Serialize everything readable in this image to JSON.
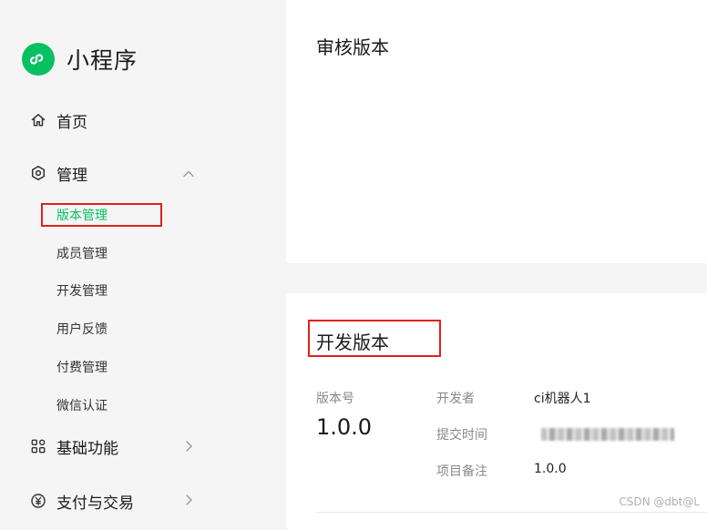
{
  "brand": {
    "title": "小程序",
    "color": "#07c160"
  },
  "nav": {
    "home": {
      "label": "首页",
      "icon": "home-icon"
    },
    "manage": {
      "label": "管理",
      "icon": "hexagon-settings-icon",
      "expanded": true
    },
    "sub_items": [
      {
        "label": "版本管理",
        "active": true
      },
      {
        "label": "成员管理",
        "active": false
      },
      {
        "label": "开发管理",
        "active": false
      },
      {
        "label": "用户反馈",
        "active": false
      },
      {
        "label": "付费管理",
        "active": false
      },
      {
        "label": "微信认证",
        "active": false
      }
    ],
    "basic": {
      "label": "基础功能",
      "icon": "grid-icon"
    },
    "payment": {
      "label": "支付与交易",
      "icon": "yen-circle-icon"
    }
  },
  "review_card": {
    "title": "审核版本"
  },
  "dev_card": {
    "title": "开发版本",
    "version_label": "版本号",
    "version_value": "1.0.0",
    "developer_label": "开发者",
    "developer_value": "ci机器人1",
    "submit_time_label": "提交时间",
    "note_label": "项目备注",
    "note_value": "1.0.0"
  },
  "watermark": "CSDN @dbt@L",
  "colors": {
    "accent": "#07c160",
    "highlight": "#e02020"
  }
}
